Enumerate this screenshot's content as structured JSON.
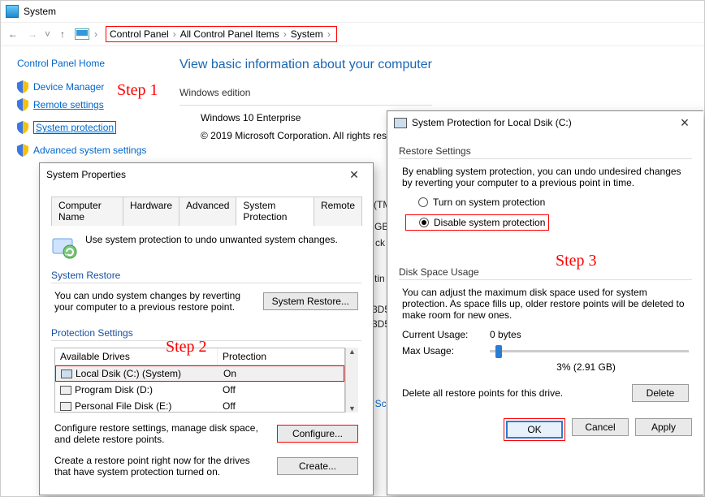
{
  "window": {
    "title": "System"
  },
  "nav": {
    "breadcrumb": [
      "Control Panel",
      "All Control Panel Items",
      "System"
    ]
  },
  "sidebar": {
    "home": "Control Panel Home",
    "items": [
      {
        "label": "Device Manager",
        "shield": true
      },
      {
        "label": "Remote settings",
        "shield": true,
        "underline": true
      },
      {
        "label": "System protection",
        "shield": true,
        "boxed": true,
        "underline": true
      },
      {
        "label": "Advanced system settings",
        "shield": true
      }
    ]
  },
  "main": {
    "title": "View basic information about your computer",
    "section1": "Windows edition",
    "edition": "Windows 10 Enterprise",
    "copyright": "© 2019 Microsoft Corporation. All rights reserved."
  },
  "props": {
    "title": "System Properties",
    "tabs": [
      "Computer Name",
      "Hardware",
      "Advanced",
      "System Protection",
      "Remote"
    ],
    "active_tab": 3,
    "intro": "Use system protection to undo unwanted system changes.",
    "group_restore": {
      "title": "System Restore",
      "text": "You can undo system changes by reverting your computer to a previous restore point.",
      "button": "System Restore..."
    },
    "group_settings": {
      "title": "Protection Settings",
      "columns": [
        "Available Drives",
        "Protection"
      ],
      "drives": [
        {
          "name": "Local Dsik (C:) (System)",
          "protection": "On",
          "selected": true
        },
        {
          "name": "Program Disk  (D:)",
          "protection": "Off"
        },
        {
          "name": "Personal File Disk (E:)",
          "protection": "Off"
        }
      ],
      "configure_text": "Configure restore settings, manage disk space, and delete restore points.",
      "configure_btn": "Configure...",
      "create_text": "Create a restore point right now for the drives that have system protection turned on.",
      "create_btn": "Create..."
    }
  },
  "prot": {
    "title": "System Protection for Local Dsik (C:)",
    "group_restore": {
      "title": "Restore Settings",
      "text": "By enabling system protection, you can undo undesired changes by reverting your computer to a previous point in time.",
      "opt_on": "Turn on system protection",
      "opt_off": "Disable system protection",
      "selected": "off"
    },
    "group_disk": {
      "title": "Disk Space Usage",
      "text": "You can adjust the maximum disk space used for system protection. As space fills up, older restore points will be deleted to make room for new ones.",
      "current_k": "Current Usage:",
      "current_v": "0 bytes",
      "max_k": "Max Usage:",
      "slider_pct": 3,
      "slider_label": "3% (2.91 GB)",
      "delete_text": "Delete all restore points for this drive.",
      "delete_btn": "Delete"
    },
    "buttons": {
      "ok": "OK",
      "cancel": "Cancel",
      "apply": "Apply"
    }
  },
  "steps": {
    "s1": "Step 1",
    "s2": "Step 2",
    "s3": "Step 3"
  },
  "fragments": {
    "tm": "(TM",
    "gb": "GB",
    "ck": "ck",
    "tin": "tin",
    "d51": "3D5",
    "d52": "3D5",
    "sc": "t Sc"
  }
}
